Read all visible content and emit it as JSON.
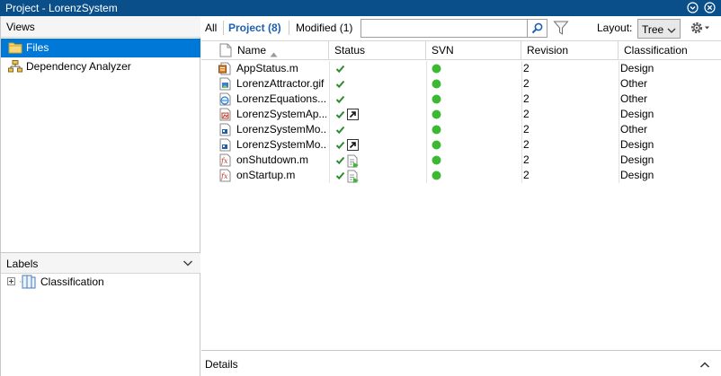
{
  "window": {
    "title": "Project - LorenzSystem"
  },
  "views_panel": {
    "header": "Views",
    "items": [
      {
        "label": "Files",
        "icon": "folder-icon",
        "selected": true
      },
      {
        "label": "Dependency Analyzer",
        "icon": "dependency-graph-icon",
        "selected": false
      }
    ]
  },
  "labels_panel": {
    "header": "Labels",
    "tree": [
      {
        "label": "Classification",
        "icon": "label-category-icon",
        "expanded": false
      }
    ]
  },
  "toolbar": {
    "tabs": [
      {
        "label": "All",
        "active": false
      },
      {
        "label": "Project (8)",
        "active": true
      },
      {
        "label": "Modified (1)",
        "active": false
      }
    ],
    "search_value": "",
    "layout_label": "Layout:",
    "layout_value": "Tree"
  },
  "table": {
    "columns": [
      "Name",
      "Status",
      "SVN",
      "Revision",
      "Classification"
    ],
    "sort_column": "Name",
    "sort_direction": "ascending",
    "rows": [
      {
        "name": "AppStatus.m",
        "icon": "matlab-class-file-icon",
        "status_icon": "checkmark-icon",
        "status_extra": "",
        "svn": "green-dot",
        "revision": "2",
        "classification": "Design"
      },
      {
        "name": "LorenzAttractor.gif",
        "icon": "image-file-icon",
        "status_icon": "checkmark-icon",
        "status_extra": "",
        "svn": "green-dot",
        "revision": "2",
        "classification": "Other"
      },
      {
        "name": "LorenzEquations....",
        "icon": "web-file-icon",
        "status_icon": "checkmark-icon",
        "status_extra": "",
        "svn": "green-dot",
        "revision": "2",
        "classification": "Other"
      },
      {
        "name": "LorenzSystemAp...",
        "icon": "app-file-icon",
        "status_icon": "checkmark-icon",
        "status_extra": "shortcut-icon",
        "svn": "green-dot",
        "revision": "2",
        "classification": "Design"
      },
      {
        "name": "LorenzSystemMo...",
        "icon": "model-file-icon",
        "status_icon": "checkmark-icon",
        "status_extra": "",
        "svn": "green-dot",
        "revision": "2",
        "classification": "Other"
      },
      {
        "name": "LorenzSystemMo...",
        "icon": "model-file-icon",
        "status_icon": "checkmark-icon",
        "status_extra": "shortcut-icon",
        "svn": "green-dot",
        "revision": "2",
        "classification": "Design"
      },
      {
        "name": "onShutdown.m",
        "icon": "matlab-function-file-icon",
        "status_icon": "checkmark-icon",
        "status_extra": "startup-shutdown-icon",
        "svn": "green-dot",
        "revision": "2",
        "classification": "Design"
      },
      {
        "name": "onStartup.m",
        "icon": "matlab-function-file-icon",
        "status_icon": "checkmark-icon",
        "status_extra": "startup-shutdown-icon",
        "svn": "green-dot",
        "revision": "2",
        "classification": "Design"
      }
    ]
  },
  "details_panel": {
    "label": "Details"
  },
  "colors": {
    "titlebar": "#0a4f89",
    "selection": "#0078d7",
    "active_tab": "#1d5fb0",
    "svn_ok": "#3cb832",
    "check": "#2e8b2e"
  }
}
